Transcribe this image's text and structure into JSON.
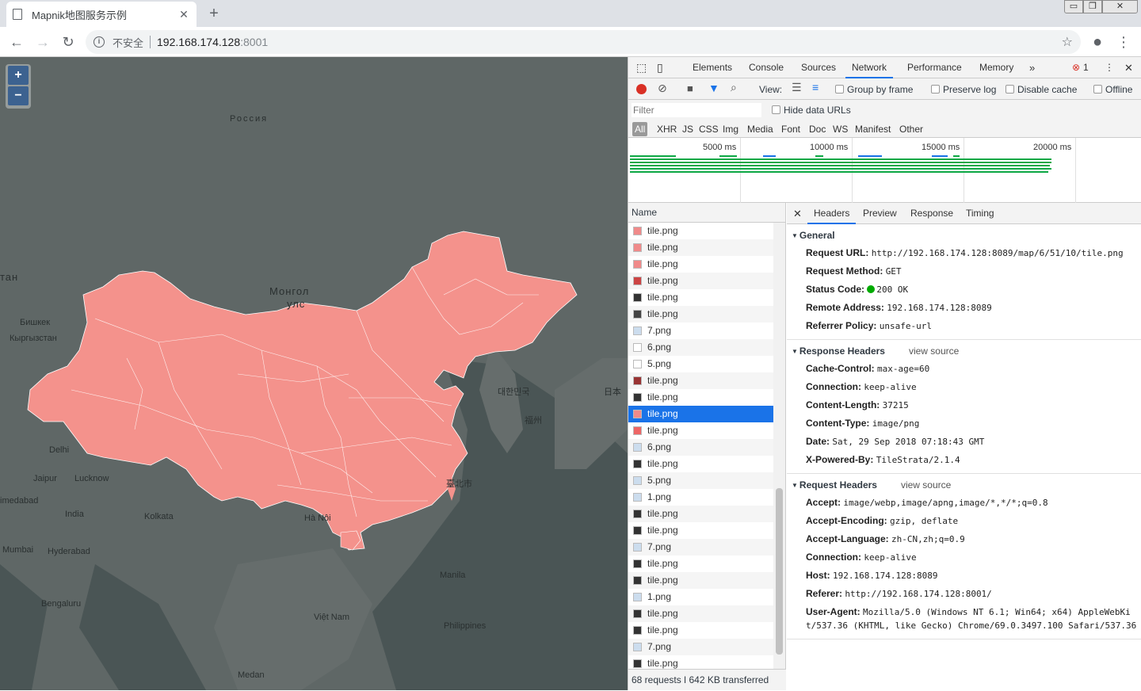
{
  "browser": {
    "tab_title": "Mapnik地图服务示例",
    "insecure_label": "不安全",
    "url_host": "192.168.174.128",
    "url_port": ":8001"
  },
  "map": {
    "zoom_in": "+",
    "zoom_out": "−",
    "labels": [
      {
        "text": "Россия"
      },
      {
        "text": "Монгол"
      },
      {
        "text": "улс"
      },
      {
        "text": "тан"
      },
      {
        "text": "Бишкек"
      },
      {
        "text": "Кыргызстан"
      },
      {
        "text": "Delhi"
      },
      {
        "text": "Jaipur"
      },
      {
        "text": "Lucknow"
      },
      {
        "text": "India"
      },
      {
        "text": "Kolkata"
      },
      {
        "text": "Hyderabad"
      },
      {
        "text": "Mumbai"
      },
      {
        "text": "imedabad"
      },
      {
        "text": "Bengaluru"
      },
      {
        "text": "Medan"
      },
      {
        "text": "Manila"
      },
      {
        "text": "Philippines"
      },
      {
        "text": "Việt Nam"
      },
      {
        "text": "Hà Nội"
      },
      {
        "text": "대한민국"
      },
      {
        "text": "日本"
      },
      {
        "text": "臺北市"
      },
      {
        "text": "福州"
      }
    ]
  },
  "devtools": {
    "tabs": [
      "Elements",
      "Console",
      "Sources",
      "Network",
      "Performance",
      "Memory"
    ],
    "error_count": "1",
    "toolbar": {
      "view_label": "View:",
      "group_by_frame": "Group by frame",
      "preserve_log": "Preserve log",
      "disable_cache": "Disable cache",
      "offline": "Offline"
    },
    "filter_placeholder": "Filter",
    "hide_data_urls": "Hide data URLs",
    "filter_types": [
      "All",
      "XHR",
      "JS",
      "CSS",
      "Img",
      "Media",
      "Font",
      "Doc",
      "WS",
      "Manifest",
      "Other"
    ],
    "timeline_ticks": [
      "5000 ms",
      "10000 ms",
      "15000 ms",
      "20000 ms"
    ],
    "list_header": "Name",
    "requests": [
      {
        "name": "tile.png",
        "thumb": "#f08a8a"
      },
      {
        "name": "tile.png",
        "thumb": "#f08a8a"
      },
      {
        "name": "tile.png",
        "thumb": "#f08a8a"
      },
      {
        "name": "tile.png",
        "thumb": "#c44"
      },
      {
        "name": "tile.png",
        "thumb": "#333"
      },
      {
        "name": "tile.png",
        "thumb": "#444"
      },
      {
        "name": "7.png",
        "thumb": "#cde"
      },
      {
        "name": "6.png",
        "thumb": "#fff"
      },
      {
        "name": "5.png",
        "thumb": "#fff"
      },
      {
        "name": "tile.png",
        "thumb": "#933"
      },
      {
        "name": "tile.png",
        "thumb": "#333"
      },
      {
        "name": "tile.png",
        "thumb": "#f08a8a"
      },
      {
        "name": "tile.png",
        "thumb": "#e66"
      },
      {
        "name": "6.png",
        "thumb": "#cde"
      },
      {
        "name": "tile.png",
        "thumb": "#333"
      },
      {
        "name": "5.png",
        "thumb": "#cde"
      },
      {
        "name": "1.png",
        "thumb": "#cde"
      },
      {
        "name": "tile.png",
        "thumb": "#333"
      },
      {
        "name": "tile.png",
        "thumb": "#333"
      },
      {
        "name": "7.png",
        "thumb": "#cde"
      },
      {
        "name": "tile.png",
        "thumb": "#333"
      },
      {
        "name": "tile.png",
        "thumb": "#333"
      },
      {
        "name": "1.png",
        "thumb": "#cde"
      },
      {
        "name": "tile.png",
        "thumb": "#333"
      },
      {
        "name": "tile.png",
        "thumb": "#333"
      },
      {
        "name": "7.png",
        "thumb": "#cde"
      },
      {
        "name": "tile.png",
        "thumb": "#333"
      }
    ],
    "selected_index": 11,
    "summary": "68 requests  ǀ  642 KB transferred",
    "detail_tabs": [
      "Headers",
      "Preview",
      "Response",
      "Timing"
    ],
    "general": {
      "title": "General",
      "items": [
        {
          "k": "Request URL:",
          "v": "http://192.168.174.128:8089/map/6/51/10/tile.png"
        },
        {
          "k": "Request Method:",
          "v": "GET"
        },
        {
          "k": "Status Code:",
          "v": "200 OK"
        },
        {
          "k": "Remote Address:",
          "v": "192.168.174.128:8089"
        },
        {
          "k": "Referrer Policy:",
          "v": "unsafe-url"
        }
      ]
    },
    "response_headers": {
      "title": "Response Headers",
      "view_source": "view source",
      "items": [
        {
          "k": "Cache-Control:",
          "v": "max-age=60"
        },
        {
          "k": "Connection:",
          "v": "keep-alive"
        },
        {
          "k": "Content-Length:",
          "v": "37215"
        },
        {
          "k": "Content-Type:",
          "v": "image/png"
        },
        {
          "k": "Date:",
          "v": "Sat, 29 Sep 2018 07:18:43 GMT"
        },
        {
          "k": "X-Powered-By:",
          "v": "TileStrata/2.1.4"
        }
      ]
    },
    "request_headers": {
      "title": "Request Headers",
      "view_source": "view source",
      "items": [
        {
          "k": "Accept:",
          "v": "image/webp,image/apng,image/*,*/*;q=0.8"
        },
        {
          "k": "Accept-Encoding:",
          "v": "gzip, deflate"
        },
        {
          "k": "Accept-Language:",
          "v": "zh-CN,zh;q=0.9"
        },
        {
          "k": "Connection:",
          "v": "keep-alive"
        },
        {
          "k": "Host:",
          "v": "192.168.174.128:8089"
        },
        {
          "k": "Referer:",
          "v": "http://192.168.174.128:8001/"
        },
        {
          "k": "User-Agent:",
          "v": "Mozilla/5.0 (Windows NT 6.1; Win64; x64) AppleWebKit/537.36 (KHTML, like Gecko) Chrome/69.0.3497.100 Safari/537.36"
        }
      ]
    }
  },
  "colors": {
    "china_fill": "#f4928c",
    "map_bg": "#5f6766",
    "selected_row": "#1a73e8",
    "record_red": "#d93025",
    "status_green": "#0a0"
  }
}
